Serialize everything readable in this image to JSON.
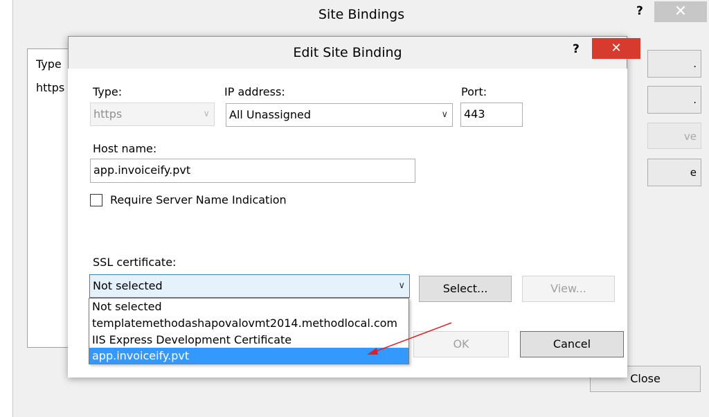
{
  "outer_window": {
    "title": "Site Bindings",
    "help": "?",
    "close": "✕",
    "list_header_type": "Type",
    "list_row_type": "https",
    "side_buttons": [
      ".",
      ".",
      "ve",
      "e"
    ],
    "close_label": "Close"
  },
  "dialog": {
    "title": "Edit Site Binding",
    "help": "?",
    "close": "✕",
    "type_label": "Type:",
    "type_value": "https",
    "ip_label": "IP address:",
    "ip_value": "All Unassigned",
    "port_label": "Port:",
    "port_value": "443",
    "host_label": "Host name:",
    "host_value": "app.invoiceify.pvt",
    "sni_label": "Require Server Name Indication",
    "sni_checked": false,
    "ssl_label": "SSL certificate:",
    "ssl_value": "Not selected",
    "select_button": "Select...",
    "view_button": "View...",
    "ok_button": "OK",
    "cancel_button": "Cancel",
    "ssl_options": [
      "Not selected",
      "templatemethodashapovalovmt2014.methodlocal.com",
      "IIS Express Development Certificate",
      "app.invoiceify.pvt"
    ],
    "ssl_highlighted_option": "app.invoiceify.pvt"
  },
  "colors": {
    "close_red": "#d63b2e",
    "highlight_blue": "#3399ff",
    "annotation_arrow": "#e02020"
  },
  "icons": {
    "dropdown": "chevron-down-icon",
    "annotation": "red-arrow-annotation"
  }
}
